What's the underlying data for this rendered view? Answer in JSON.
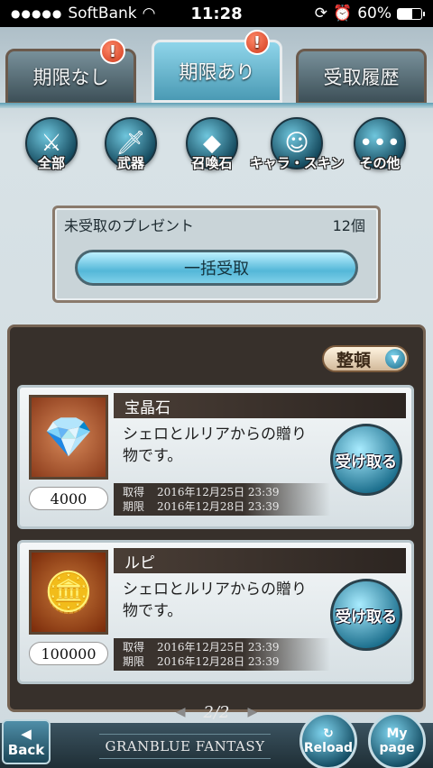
{
  "status": {
    "carrier": "SoftBank",
    "time": "11:28",
    "battery": "60%",
    "battery_level": 0.6
  },
  "tabs": [
    {
      "label": "期限なし",
      "alert": "!"
    },
    {
      "label": "期限あり",
      "alert": "!"
    },
    {
      "label": "受取履歴",
      "alert": ""
    }
  ],
  "filters": [
    {
      "label": "全部",
      "icon": "all-icon"
    },
    {
      "label": "武器",
      "icon": "weapon-icon"
    },
    {
      "label": "召喚石",
      "icon": "summon-stone-icon"
    },
    {
      "label": "キャラ・スキン",
      "icon": "character-icon"
    },
    {
      "label": "その他",
      "icon": "other-icon"
    }
  ],
  "summary": {
    "label": "未受取のプレゼント",
    "count": "12個",
    "bulk_button": "一括受取"
  },
  "sort_button": "整頓",
  "items": [
    {
      "name": "宝晶石",
      "description": "シェロとルリアからの贈り物です。",
      "amount": "4000",
      "acquired_label": "取得",
      "acquired": "2016年12月25日 23:39",
      "expires_label": "期限",
      "expires": "2016年12月28日 23:39",
      "button": "受け取る",
      "icon": "crystal-icon"
    },
    {
      "name": "ルピ",
      "description": "シェロとルリアからの贈り物です。",
      "amount": "100000",
      "acquired_label": "取得",
      "acquired": "2016年12月25日 23:39",
      "expires_label": "期限",
      "expires": "2016年12月28日 23:39",
      "button": "受け取る",
      "icon": "rupie-coins-icon"
    }
  ],
  "pager": "2/2",
  "bottom_nav": {
    "back": "Back",
    "logo": "GRANBLUE FANTASY",
    "reload": "Reload",
    "mypage_line1": "My",
    "mypage_line2": "page"
  }
}
